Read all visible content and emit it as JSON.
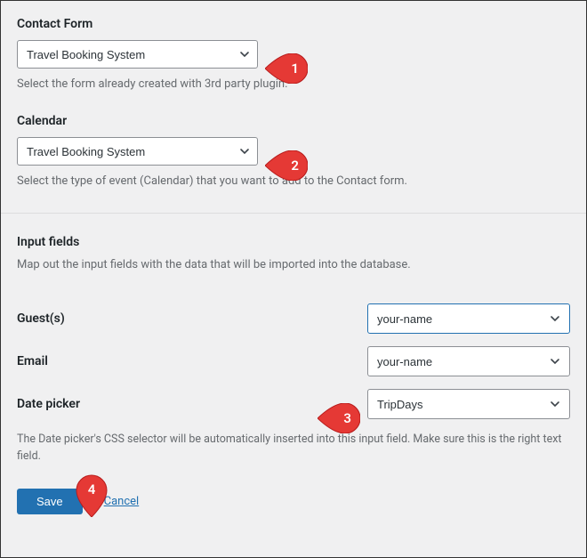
{
  "contact_form": {
    "label": "Contact Form",
    "value": "Travel Booking System",
    "helper": "Select the form already created with 3rd party plugin."
  },
  "calendar": {
    "label": "Calendar",
    "value": "Travel Booking System",
    "helper": "Select the type of event (Calendar) that you want to add to the Contact form."
  },
  "input_fields": {
    "title": "Input fields",
    "subtitle": "Map out the input fields with the data that will be imported into the database."
  },
  "rows": {
    "guests": {
      "label": "Guest(s)",
      "value": "your-name"
    },
    "email": {
      "label": "Email",
      "value": "your-name"
    },
    "date_picker": {
      "label": "Date picker",
      "value": "TripDays"
    }
  },
  "footnote": "The Date picker's CSS selector will be automatically inserted into this input field. Make sure this is the right text field.",
  "actions": {
    "save": "Save",
    "cancel": "Cancel"
  },
  "callouts": {
    "c1": "1",
    "c2": "2",
    "c3": "3",
    "c4": "4"
  }
}
